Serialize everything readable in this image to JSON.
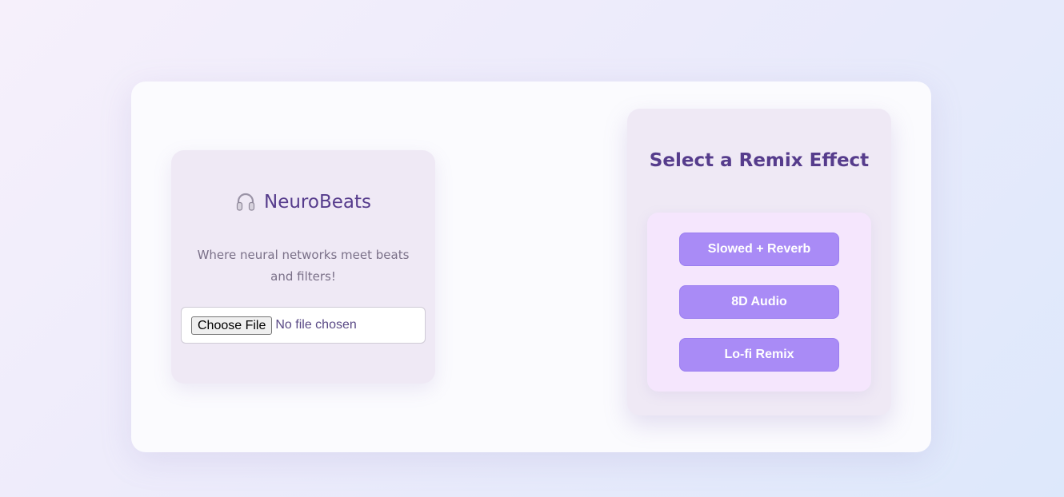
{
  "app": {
    "icon": "headphones-icon",
    "name": "NeuroBeats",
    "tagline": "Where neural networks meet beats and filters!"
  },
  "upload": {
    "button_label": "Choose File",
    "status": "No file chosen"
  },
  "effects": {
    "title": "Select a Remix Effect",
    "buttons": [
      {
        "label": "Slowed + Reverb"
      },
      {
        "label": "8D Audio"
      },
      {
        "label": "Lo-fi Remix"
      }
    ]
  },
  "colors": {
    "accent": "#a98bf6",
    "heading": "#563c8c",
    "panel": "#efe9f5",
    "effects_box": "#f5e6fd"
  }
}
